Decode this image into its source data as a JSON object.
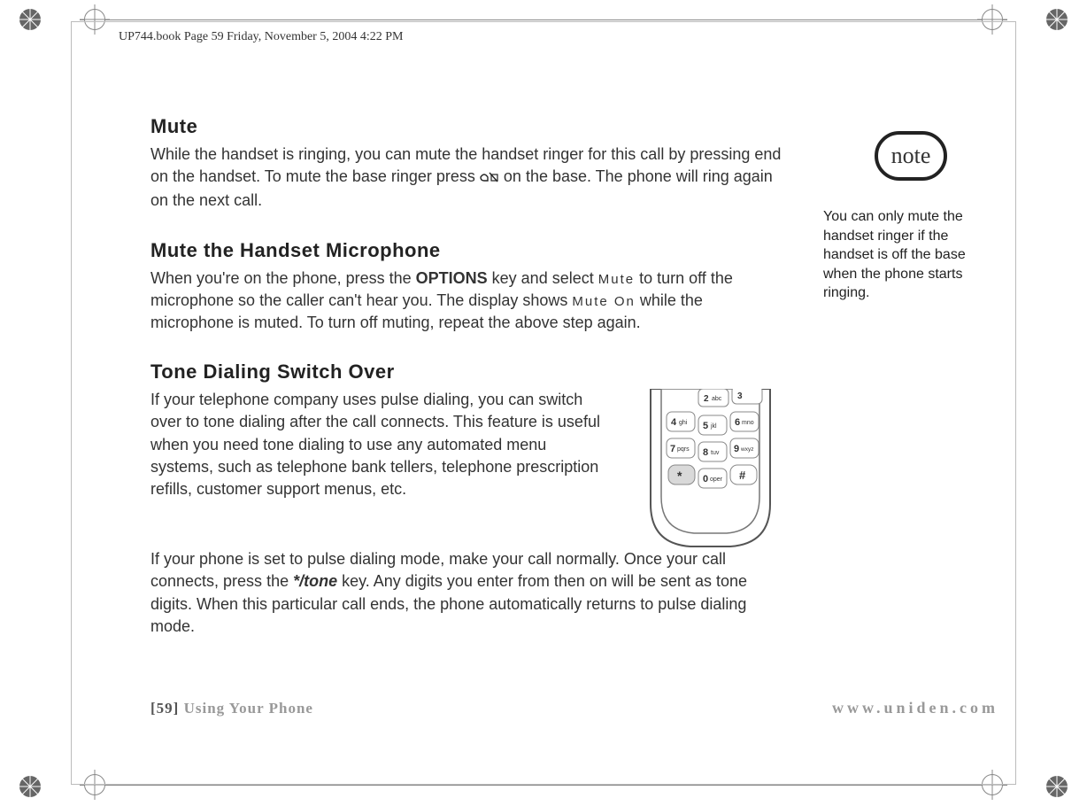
{
  "running_header": "UP744.book  Page 59  Friday, November 5, 2004  4:22 PM",
  "sections": {
    "mute": {
      "heading": "Mute",
      "body_before_icon": "While the handset is ringing, you can mute the handset ringer for this call by pressing end on the handset. To mute the base ringer press ",
      "body_after_icon": " on the base. The phone will ring again on the next call."
    },
    "mute_mic": {
      "heading": "Mute the Handset Microphone",
      "body_1": "When you're on the phone, press the ",
      "options_label": "OPTIONS",
      "body_2": " key and select ",
      "mono_mute": "Mute",
      "body_3": " to turn off the microphone so the caller can't hear you. The display shows ",
      "mono_mute_on": "Mute On",
      "body_4": " while the microphone is muted. To turn off muting, repeat the above step again."
    },
    "tone": {
      "heading": "Tone Dialing Switch Over",
      "para1": "If your telephone company uses pulse dialing, you can switch over to tone dialing after the call connects. This feature is useful when you need tone dialing to use any automated menu systems, such as telephone bank tellers, telephone prescription refills, customer support menus, etc.",
      "para2_a": "If your phone is set to pulse dialing mode, make your call normally. Once your call connects, press the ",
      "star_tone": "*/tone",
      "para2_b": " key. Any digits you enter from then on will be sent as tone digits. When this particular call ends, the phone automatically returns to pulse dialing mode."
    }
  },
  "note": {
    "label": "note",
    "text": "You can only mute the handset ringer if the handset is off the base when the phone starts ringing."
  },
  "keypad": {
    "keys": [
      {
        "num": "2",
        "letters": "abc"
      },
      {
        "num": "3",
        "letters": ""
      },
      {
        "num": "4",
        "letters": "ghi"
      },
      {
        "num": "5",
        "letters": "jkl"
      },
      {
        "num": "6",
        "letters": "mno"
      },
      {
        "num": "7",
        "letters": "pqrs"
      },
      {
        "num": "8",
        "letters": "tuv"
      },
      {
        "num": "9",
        "letters": "wxyz"
      },
      {
        "num": "*",
        "letters": ""
      },
      {
        "num": "0",
        "letters": "oper"
      },
      {
        "num": "#",
        "letters": ""
      }
    ]
  },
  "footer": {
    "page_num": "[59]",
    "section": "Using Your Phone",
    "url": "www.uniden.com"
  }
}
